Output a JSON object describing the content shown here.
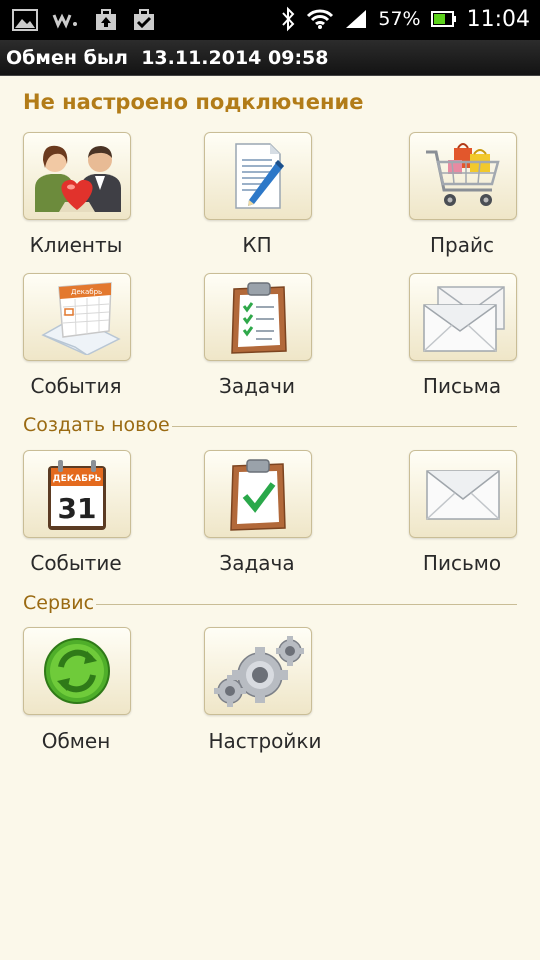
{
  "status_bar": {
    "battery": "57%",
    "time": "11:04"
  },
  "header": {
    "exchange_label": "Обмен был",
    "exchange_datetime": "13.11.2014 09:58"
  },
  "warning": "Не настроено подключение",
  "main_items": [
    {
      "label": "Клиенты",
      "icon": "clients-icon"
    },
    {
      "label": "КП",
      "icon": "document-pen-icon"
    },
    {
      "label": "Прайс",
      "icon": "shopping-cart-icon"
    },
    {
      "label": "События",
      "icon": "calendar-icon"
    },
    {
      "label": "Задачи",
      "icon": "clipboard-checklist-icon"
    },
    {
      "label": "Письма",
      "icon": "envelopes-icon"
    }
  ],
  "create_section": {
    "title": "Создать новое",
    "items": [
      {
        "label": "Событие",
        "icon": "calendar-day-icon"
      },
      {
        "label": "Задача",
        "icon": "clipboard-check-icon"
      },
      {
        "label": "Письмо",
        "icon": "envelope-icon"
      }
    ]
  },
  "calendar_page": {
    "month": "ДЕКАБРЬ",
    "day": "31"
  },
  "calendar_small_month": "Декабрь",
  "service_section": {
    "title": "Сервис",
    "items": [
      {
        "label": "Обмен",
        "icon": "sync-icon"
      },
      {
        "label": "Настройки",
        "icon": "gears-icon"
      }
    ]
  },
  "colors": {
    "background": "#fbf8ea",
    "section_title": "#9a6a12",
    "warning": "#b27c18",
    "tile_border": "#c9bd96"
  }
}
